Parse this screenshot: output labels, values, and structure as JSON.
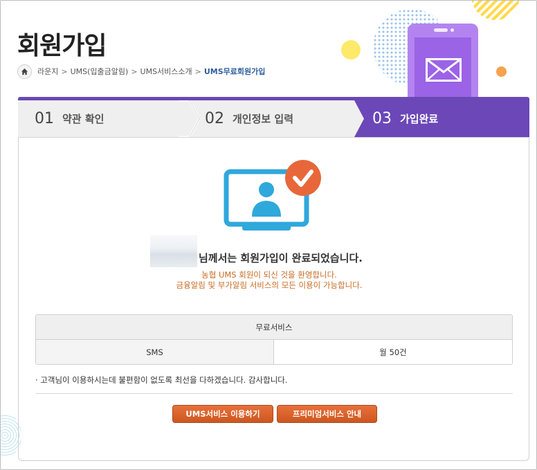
{
  "page": {
    "title": "회원가입"
  },
  "breadcrumb": {
    "items": [
      "라운지",
      "UMS(입출금알림)",
      "UMS서비스소개"
    ],
    "current": "UMS무료회원가입",
    "separator": ">"
  },
  "steps": [
    {
      "num": "01",
      "label": "약관 확인"
    },
    {
      "num": "02",
      "label": "개인정보 입력"
    },
    {
      "num": "03",
      "label": "가입완료"
    }
  ],
  "completion": {
    "main": "님께서는 회원가입이 완료되었습니다.",
    "sub1": "농협 UMS 회원이 되신 것을 환영합니다.",
    "sub2": "금융알림 및 부가알림 서비스의 모든 이용이 가능합니다."
  },
  "service_table": {
    "header": "무료서비스",
    "rows": [
      {
        "name": "SMS",
        "value": "월 50건"
      }
    ]
  },
  "note": "· 고객님이 이용하시는데 불편함이 없도록 최선을 다하겠습니다. 감사합니다.",
  "buttons": {
    "ums": "UMS서비스 이용하기",
    "premium": "프리미엄서비스 안내"
  },
  "colors": {
    "accent_purple": "#6b47b8",
    "button_orange": "#d9602a",
    "monitor_blue": "#2fa8db",
    "check_orange": "#e8673a"
  },
  "icons": [
    "home-icon",
    "envelope-icon",
    "monitor-user-icon",
    "check-icon"
  ]
}
